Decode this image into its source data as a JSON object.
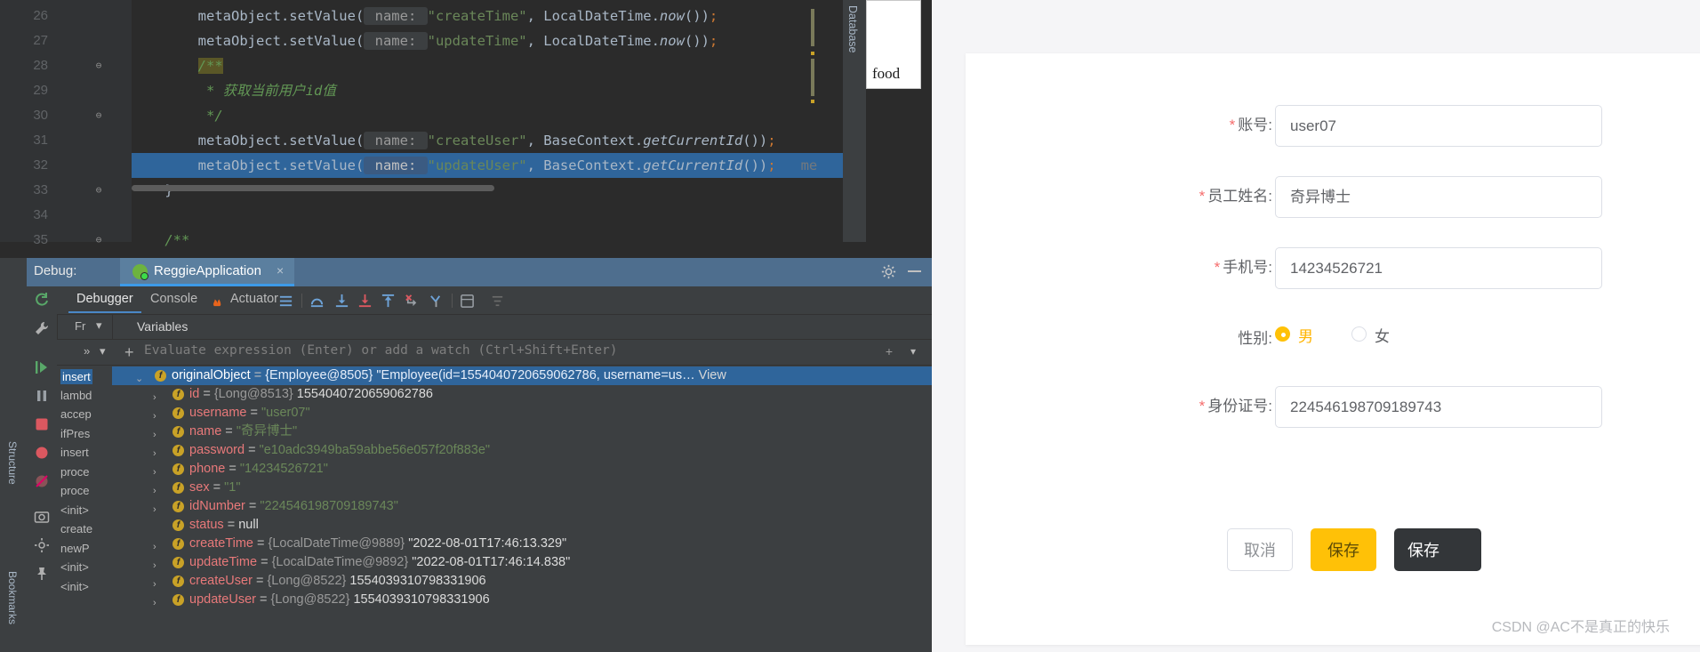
{
  "ide": {
    "editor": {
      "lines": [
        {
          "no": "26",
          "indent": 8,
          "fold": "",
          "text_parts": [
            {
              "t": "metaObject.setValue(",
              "c": "plain"
            },
            {
              "t": " name: ",
              "c": "hint"
            },
            {
              "t": "\"createTime\"",
              "c": "str"
            },
            {
              "t": ", LocalDateTime.",
              "c": "plain"
            },
            {
              "t": "now",
              "c": "itl"
            },
            {
              "t": "())",
              "c": "plain"
            },
            {
              "t": ";",
              "c": "kw"
            }
          ]
        },
        {
          "no": "27",
          "indent": 8,
          "fold": "",
          "text_parts": [
            {
              "t": "metaObject.setValue(",
              "c": "plain"
            },
            {
              "t": " name: ",
              "c": "hint"
            },
            {
              "t": "\"updateTime\"",
              "c": "str"
            },
            {
              "t": ", LocalDateTime.",
              "c": "plain"
            },
            {
              "t": "now",
              "c": "itl"
            },
            {
              "t": "())",
              "c": "plain"
            },
            {
              "t": ";",
              "c": "kw"
            }
          ]
        },
        {
          "no": "28",
          "indent": 8,
          "fold": "⊖",
          "text_parts": [
            {
              "t": "/**",
              "c": "cmtbg"
            }
          ]
        },
        {
          "no": "29",
          "indent": 9,
          "fold": "",
          "text_parts": [
            {
              "t": "* 获取当前用户id值",
              "c": "cmt"
            }
          ]
        },
        {
          "no": "30",
          "indent": 9,
          "fold": "⊖",
          "text_parts": [
            {
              "t": "*/",
              "c": "cmt"
            }
          ]
        },
        {
          "no": "31",
          "indent": 8,
          "fold": "",
          "text_parts": [
            {
              "t": "metaObject.setValue(",
              "c": "plain"
            },
            {
              "t": " name: ",
              "c": "hint"
            },
            {
              "t": "\"createUser\"",
              "c": "str"
            },
            {
              "t": ", BaseContext.",
              "c": "plain"
            },
            {
              "t": "getCurrentId",
              "c": "itl"
            },
            {
              "t": "())",
              "c": "plain"
            },
            {
              "t": ";",
              "c": "kw"
            }
          ]
        },
        {
          "no": "32",
          "indent": 8,
          "fold": "",
          "selected": true,
          "text_parts": [
            {
              "t": "metaObject.setValue(",
              "c": "plain"
            },
            {
              "t": " name: ",
              "c": "hint-sel"
            },
            {
              "t": "\"updateUser\"",
              "c": "str"
            },
            {
              "t": ", BaseContext.",
              "c": "plain"
            },
            {
              "t": "getCurrentId",
              "c": "itl"
            },
            {
              "t": "())",
              "c": "plain"
            },
            {
              "t": ";",
              "c": "kw"
            },
            {
              "t": "   me",
              "c": "grayed"
            }
          ]
        },
        {
          "no": "33",
          "indent": 4,
          "fold": "⊖",
          "text_parts": [
            {
              "t": "}",
              "c": "plain"
            }
          ]
        },
        {
          "no": "34",
          "indent": 4,
          "fold": "",
          "text_parts": []
        },
        {
          "no": "35",
          "indent": 4,
          "fold": "⊖",
          "text_parts": [
            {
              "t": "/**",
              "c": "cmt"
            }
          ]
        }
      ],
      "right_tool_label": "Database",
      "popup_text": "food"
    },
    "debug": {
      "title": "Debug:",
      "run_config": "ReggieApplication",
      "close": "×",
      "tabs": [
        {
          "label": "Debugger",
          "active": true
        },
        {
          "label": "Console",
          "active": false
        },
        {
          "label": "Actuator",
          "active": false
        }
      ],
      "frames_label": "Fr",
      "variables_label": "Variables",
      "eval_placeholder": "Evaluate expression (Enter) or add a watch (Ctrl+Shift+Enter)",
      "frames": [
        {
          "label": "insert",
          "selected": true
        },
        {
          "label": "lambd",
          "selected": false
        },
        {
          "label": "accep",
          "selected": false
        },
        {
          "label": "ifPres",
          "selected": false
        },
        {
          "label": "insert",
          "selected": false
        },
        {
          "label": "proce",
          "selected": false
        },
        {
          "label": "proce",
          "selected": false
        },
        {
          "label": "<init>",
          "selected": false
        },
        {
          "label": "create",
          "selected": false
        },
        {
          "label": "newP",
          "selected": false
        },
        {
          "label": "<init>",
          "selected": false
        },
        {
          "label": "<init>",
          "selected": false
        }
      ],
      "variables": [
        {
          "indent": 0,
          "arrow": "⌄",
          "icon": "f",
          "name": "originalObject",
          "type": "{Employee@8505}",
          "value": "\"Employee(id=1554040720659062786, username=us…",
          "valueClass": "str",
          "trailing": " View",
          "selected": true
        },
        {
          "indent": 1,
          "arrow": "›",
          "icon": "f",
          "name": "id",
          "type": "{Long@8513}",
          "value": "1554040720659062786",
          "valueClass": "num"
        },
        {
          "indent": 1,
          "arrow": "›",
          "icon": "f",
          "name": "username",
          "type": "",
          "value": "\"user07\"",
          "valueClass": "str"
        },
        {
          "indent": 1,
          "arrow": "›",
          "icon": "f",
          "name": "name",
          "type": "",
          "value": "\"奇异博士\"",
          "valueClass": "str"
        },
        {
          "indent": 1,
          "arrow": "›",
          "icon": "f",
          "name": "password",
          "type": "",
          "value": "\"e10adc3949ba59abbe56e057f20f883e\"",
          "valueClass": "str"
        },
        {
          "indent": 1,
          "arrow": "›",
          "icon": "f",
          "name": "phone",
          "type": "",
          "value": "\"14234526721\"",
          "valueClass": "str"
        },
        {
          "indent": 1,
          "arrow": "›",
          "icon": "f",
          "name": "sex",
          "type": "",
          "value": "\"1\"",
          "valueClass": "str"
        },
        {
          "indent": 1,
          "arrow": "›",
          "icon": "f",
          "name": "idNumber",
          "type": "",
          "value": "\"224546198709189743\"",
          "valueClass": "str"
        },
        {
          "indent": 1,
          "arrow": "",
          "icon": "f",
          "name": "status",
          "type": "",
          "value": "null",
          "valueClass": "null"
        },
        {
          "indent": 1,
          "arrow": "›",
          "icon": "f",
          "name": "createTime",
          "type": "{LocalDateTime@9889}",
          "value": "\"2022-08-01T17:46:13.329\"",
          "valueClass": "num"
        },
        {
          "indent": 1,
          "arrow": "›",
          "icon": "f",
          "name": "updateTime",
          "type": "{LocalDateTime@9892}",
          "value": "\"2022-08-01T17:46:14.838\"",
          "valueClass": "num"
        },
        {
          "indent": 1,
          "arrow": "›",
          "icon": "f",
          "name": "createUser",
          "type": "{Long@8522}",
          "value": "1554039310798331906",
          "valueClass": "num"
        },
        {
          "indent": 1,
          "arrow": "›",
          "icon": "f",
          "name": "updateUser",
          "type": "{Long@8522}",
          "value": "1554039310798331906",
          "valueClass": "num"
        }
      ]
    },
    "left_rail": [
      "Structure",
      "Bookmarks"
    ]
  },
  "form": {
    "fields": [
      {
        "label": "账号:",
        "required": true,
        "value": "user07"
      },
      {
        "label": "员工姓名:",
        "required": true,
        "value": "奇异博士"
      },
      {
        "label": "手机号:",
        "required": true,
        "value": "14234526721"
      }
    ],
    "gender": {
      "label": "性别:",
      "options": [
        {
          "label": "男",
          "selected": true
        },
        {
          "label": "女",
          "selected": false
        }
      ]
    },
    "id_field": {
      "label": "身份证号:",
      "required": true,
      "value": "224546198709189743"
    },
    "buttons": [
      {
        "label": "取消",
        "kind": "cancel"
      },
      {
        "label": "保存",
        "kind": "save"
      },
      {
        "label": "保存",
        "kind": "save-and-add"
      }
    ]
  },
  "watermark": "CSDN @AC不是真正的快乐",
  "colors": {
    "accent_yellow": "#ffc107",
    "ide_bg": "#2b2b2b",
    "panel_bg": "#3c3f41",
    "select_blue": "#2f659b",
    "required_red": "#f56c6c"
  }
}
